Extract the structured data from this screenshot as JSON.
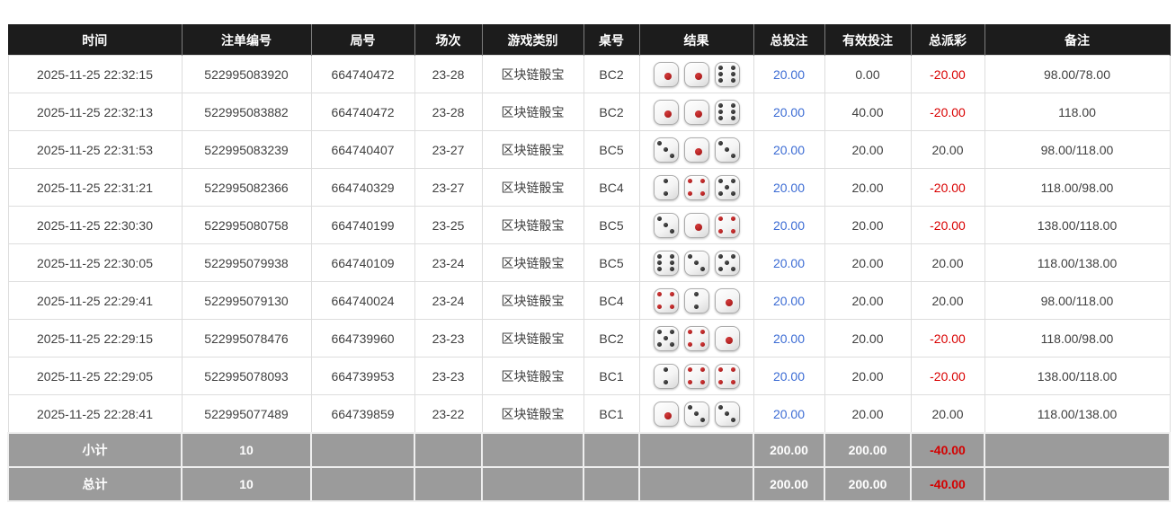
{
  "colors": {
    "header_bg": "#1c1c1c",
    "summary_bg": "#9b9b9b",
    "total_bet_blue": "#3c6cd4",
    "negative_red": "#d90000",
    "dice_red_pips": "#9c1010",
    "dice_black_pips": "#151515"
  },
  "table": {
    "headers": [
      "时间",
      "注单编号",
      "局号",
      "场次",
      "游戏类别",
      "桌号",
      "结果",
      "总投注",
      "有效投注",
      "总派彩",
      "备注"
    ],
    "rows": [
      {
        "time": "2025-11-25 22:32:15",
        "bet_id": "522995083920",
        "round_id": "664740472",
        "session": "23-28",
        "game_type": "区块链骰宝",
        "table_no": "BC2",
        "dice": [
          1,
          1,
          6
        ],
        "total_bet": "20.00",
        "valid_bet": "0.00",
        "payout": "-20.00",
        "remark": "98.00/78.00"
      },
      {
        "time": "2025-11-25 22:32:13",
        "bet_id": "522995083882",
        "round_id": "664740472",
        "session": "23-28",
        "game_type": "区块链骰宝",
        "table_no": "BC2",
        "dice": [
          1,
          1,
          6
        ],
        "total_bet": "20.00",
        "valid_bet": "40.00",
        "payout": "-20.00",
        "remark": "118.00"
      },
      {
        "time": "2025-11-25 22:31:53",
        "bet_id": "522995083239",
        "round_id": "664740407",
        "session": "23-27",
        "game_type": "区块链骰宝",
        "table_no": "BC5",
        "dice": [
          3,
          1,
          3
        ],
        "total_bet": "20.00",
        "valid_bet": "20.00",
        "payout": "20.00",
        "remark": "98.00/118.00"
      },
      {
        "time": "2025-11-25 22:31:21",
        "bet_id": "522995082366",
        "round_id": "664740329",
        "session": "23-27",
        "game_type": "区块链骰宝",
        "table_no": "BC4",
        "dice": [
          2,
          4,
          5
        ],
        "total_bet": "20.00",
        "valid_bet": "20.00",
        "payout": "-20.00",
        "remark": "118.00/98.00"
      },
      {
        "time": "2025-11-25 22:30:30",
        "bet_id": "522995080758",
        "round_id": "664740199",
        "session": "23-25",
        "game_type": "区块链骰宝",
        "table_no": "BC5",
        "dice": [
          3,
          1,
          4
        ],
        "total_bet": "20.00",
        "valid_bet": "20.00",
        "payout": "-20.00",
        "remark": "138.00/118.00"
      },
      {
        "time": "2025-11-25 22:30:05",
        "bet_id": "522995079938",
        "round_id": "664740109",
        "session": "23-24",
        "game_type": "区块链骰宝",
        "table_no": "BC5",
        "dice": [
          6,
          3,
          5
        ],
        "total_bet": "20.00",
        "valid_bet": "20.00",
        "payout": "20.00",
        "remark": "118.00/138.00"
      },
      {
        "time": "2025-11-25 22:29:41",
        "bet_id": "522995079130",
        "round_id": "664740024",
        "session": "23-24",
        "game_type": "区块链骰宝",
        "table_no": "BC4",
        "dice": [
          4,
          2,
          1
        ],
        "total_bet": "20.00",
        "valid_bet": "20.00",
        "payout": "20.00",
        "remark": "98.00/118.00"
      },
      {
        "time": "2025-11-25 22:29:15",
        "bet_id": "522995078476",
        "round_id": "664739960",
        "session": "23-23",
        "game_type": "区块链骰宝",
        "table_no": "BC2",
        "dice": [
          5,
          4,
          1
        ],
        "total_bet": "20.00",
        "valid_bet": "20.00",
        "payout": "-20.00",
        "remark": "118.00/98.00"
      },
      {
        "time": "2025-11-25 22:29:05",
        "bet_id": "522995078093",
        "round_id": "664739953",
        "session": "23-23",
        "game_type": "区块链骰宝",
        "table_no": "BC1",
        "dice": [
          2,
          4,
          4
        ],
        "total_bet": "20.00",
        "valid_bet": "20.00",
        "payout": "-20.00",
        "remark": "138.00/118.00"
      },
      {
        "time": "2025-11-25 22:28:41",
        "bet_id": "522995077489",
        "round_id": "664739859",
        "session": "23-22",
        "game_type": "区块链骰宝",
        "table_no": "BC1",
        "dice": [
          1,
          3,
          3
        ],
        "total_bet": "20.00",
        "valid_bet": "20.00",
        "payout": "20.00",
        "remark": "118.00/138.00"
      }
    ],
    "summary_rows": [
      {
        "label": "小计",
        "count": "10",
        "total_bet": "200.00",
        "valid_bet": "200.00",
        "payout": "-40.00",
        "remark": ""
      },
      {
        "label": "总计",
        "count": "10",
        "total_bet": "200.00",
        "valid_bet": "200.00",
        "payout": "-40.00",
        "remark": ""
      }
    ]
  }
}
